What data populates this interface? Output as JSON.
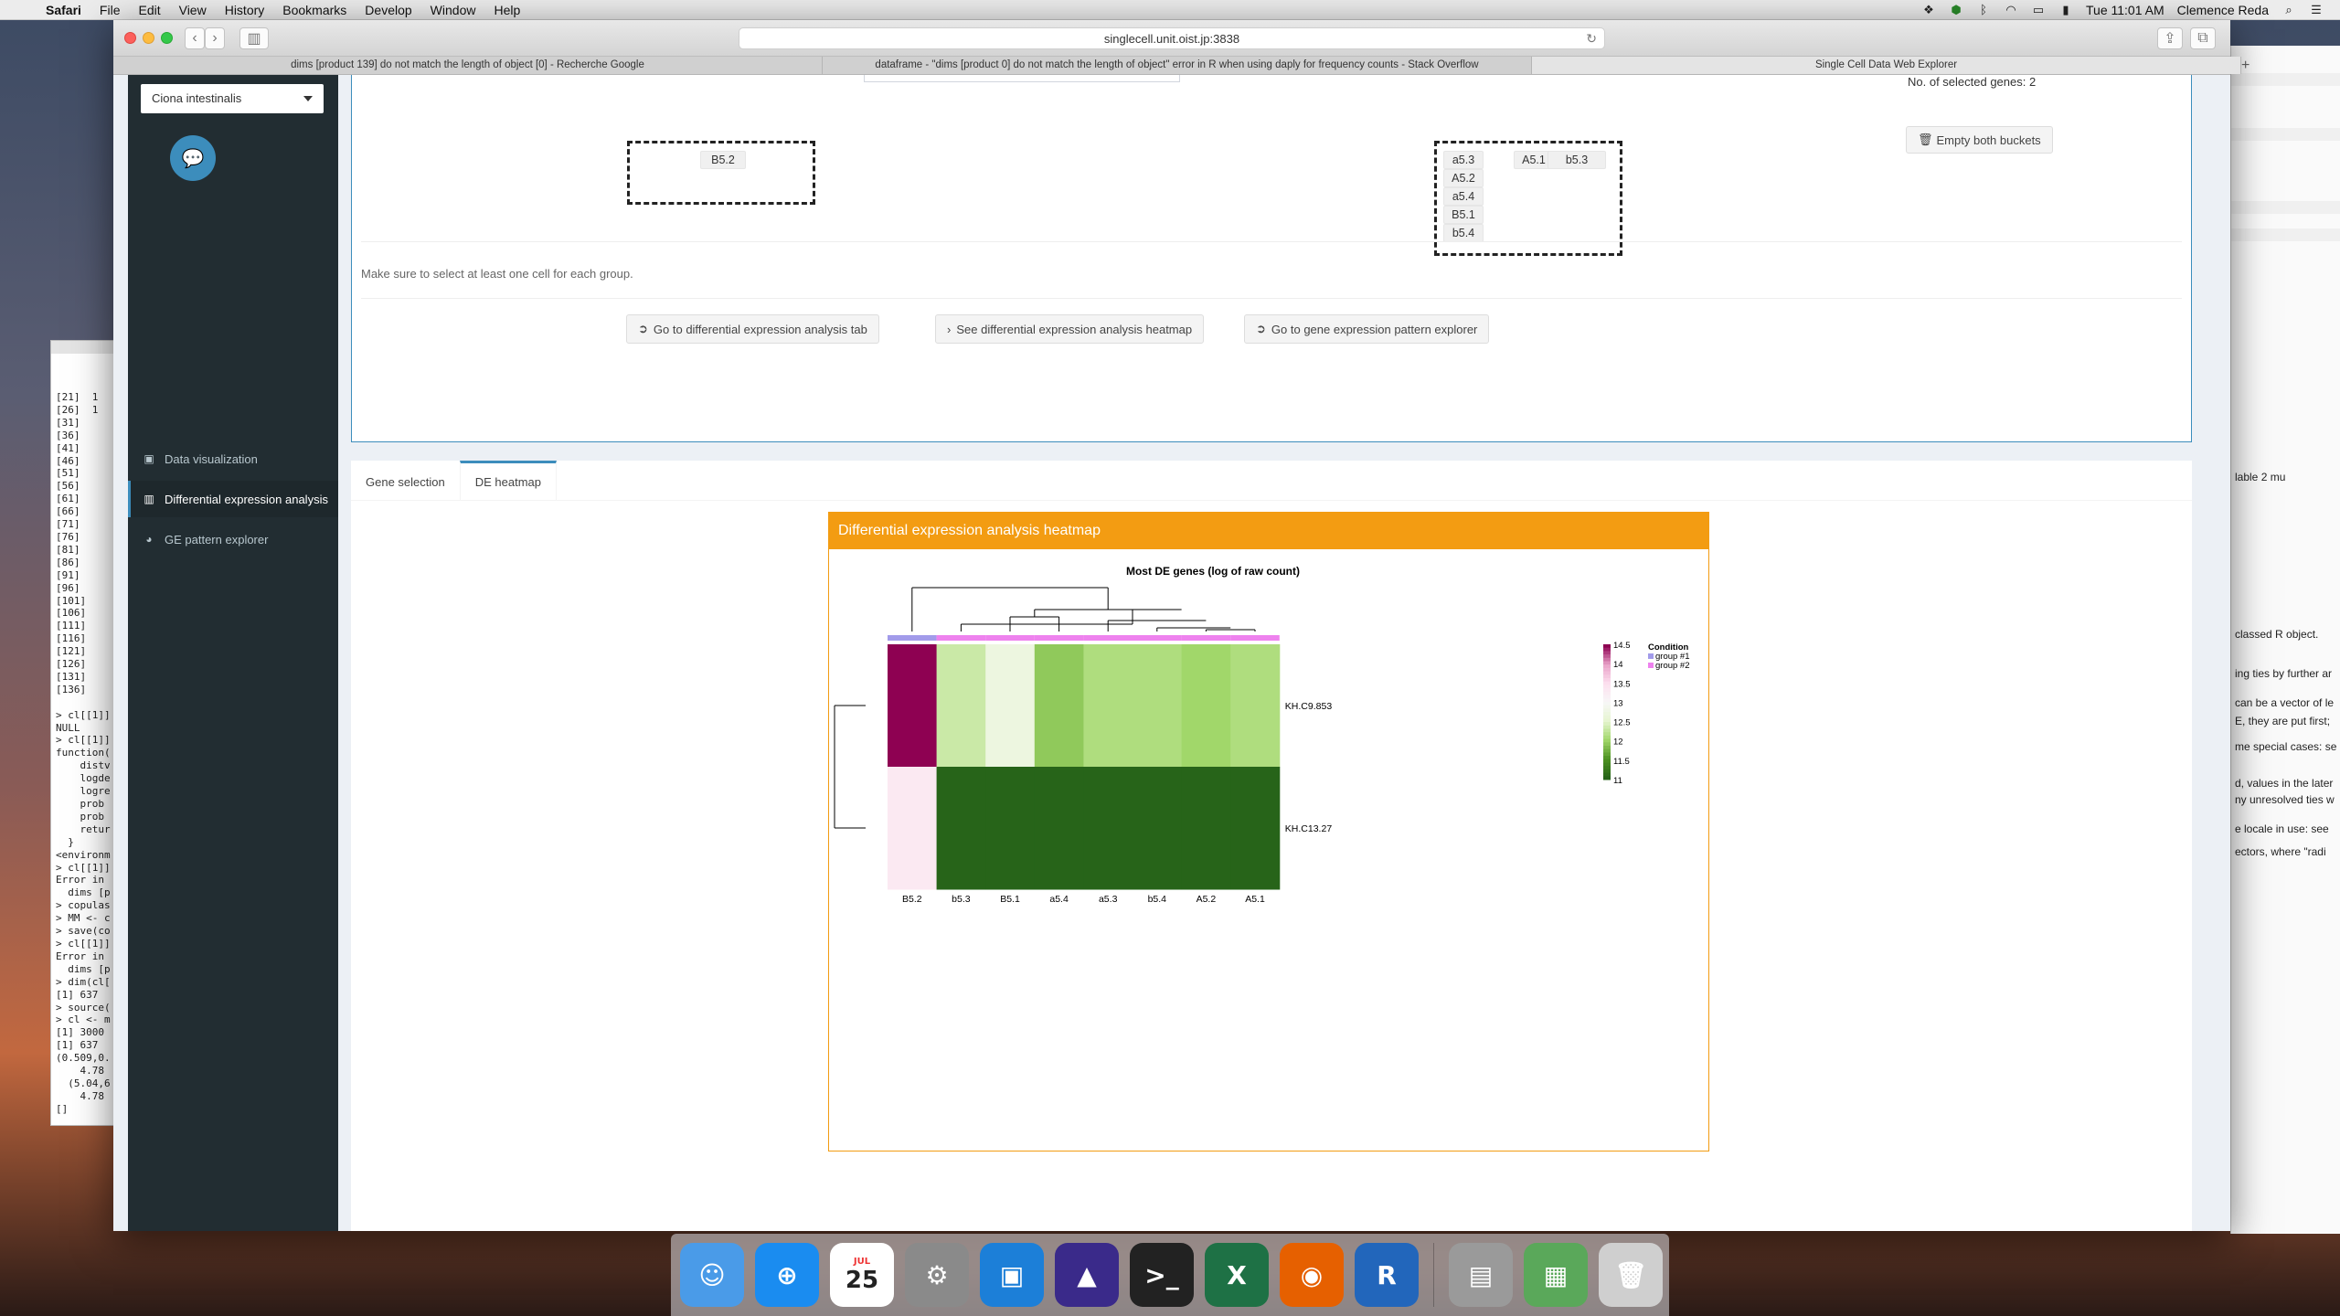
{
  "menubar": {
    "app": "Safari",
    "items": [
      "File",
      "Edit",
      "View",
      "History",
      "Bookmarks",
      "Develop",
      "Window",
      "Help"
    ],
    "clock": "Tue 11:01 AM",
    "user": "Clemence Reda"
  },
  "browser": {
    "url": "singlecell.unit.oist.jp:3838",
    "tabs": [
      "dims [product 139] do not match the length of object [0] - Recherche Google",
      "dataframe - \"dims [product 0] do not match the length of object\" error in R when using daply for frequency counts - Stack Overflow",
      "Single Cell Data Web Explorer"
    ],
    "new_tab": "+"
  },
  "sidebar": {
    "species": "Ciona intestinalis",
    "items": [
      {
        "label": "Data visualization",
        "icon": "image-icon",
        "glyph": "▣"
      },
      {
        "label": "Differential expression analysis",
        "icon": "bar-chart-icon",
        "glyph": "▥"
      },
      {
        "label": "GE pattern explorer",
        "icon": "pie-chart-icon",
        "glyph": "◕"
      }
    ]
  },
  "topbox": {
    "selected_genes": "No. of selected genes: 2",
    "bucket1": [
      "B5.2"
    ],
    "bucket2_col1": [
      "a5.3",
      "A5.2",
      "a5.4",
      "B5.1",
      "b5.4"
    ],
    "bucket2_col2": [
      "A5.1"
    ],
    "bucket2_col3": [
      "b5.3"
    ],
    "empty_buckets": "Empty both buckets",
    "note": "Make sure to select at least one cell for each group.",
    "buttons": {
      "go_de_tab": "Go to differential expression analysis tab",
      "see_heatmap": "See differential expression analysis heatmap",
      "go_ge_explorer": "Go to gene expression pattern explorer"
    }
  },
  "tabs": {
    "gene_selection": "Gene selection",
    "de_heatmap": "DE heatmap"
  },
  "heatmap": {
    "box_title": "Differential expression analysis heatmap",
    "plot_title": "Most DE genes (log of raw count)",
    "legend_title": "Condition",
    "legend_groups": [
      "group #1",
      "group #2"
    ],
    "group_colors": [
      "#a29bea",
      "#ee82ee"
    ]
  },
  "chart_data": {
    "type": "heatmap",
    "title": "Most DE genes (log of raw count)",
    "columns": [
      "B5.2",
      "b5.3",
      "B5.1",
      "a5.4",
      "a5.3",
      "b5.4",
      "A5.2",
      "A5.1"
    ],
    "column_group": [
      "group #1",
      "group #2",
      "group #2",
      "group #2",
      "group #2",
      "group #2",
      "group #2",
      "group #2"
    ],
    "rows": [
      "KH.C9.853",
      "KH.C13.27"
    ],
    "values": [
      [
        14.6,
        12.3,
        12.7,
        11.9,
        12.1,
        12.1,
        12.0,
        12.1
      ],
      [
        13.3,
        10.8,
        10.8,
        10.6,
        10.4,
        10.5,
        10.5,
        10.6
      ]
    ],
    "color_scale": {
      "min": 11,
      "max": 14.5,
      "ticks": [
        14.5,
        14,
        13.5,
        13,
        12.5,
        12,
        11.5,
        11
      ]
    }
  },
  "console": {
    "lines": [
      "[21]  1",
      "[26]  1",
      "[31]",
      "[36]",
      "[41]",
      "[46]",
      "[51]",
      "[56]",
      "[61]",
      "[66]",
      "[71]",
      "[76]",
      "[81]",
      "[86]",
      "[91]",
      "[96]",
      "[101]",
      "[106]",
      "[111]",
      "[116]",
      "[121]",
      "[126]",
      "[131]",
      "[136]",
      "",
      "> cl[[1]]",
      "NULL",
      "> cl[[1]]",
      "function(",
      "    distv",
      "    logde",
      "    logre",
      "    prob ",
      "    prob ",
      "    retur",
      "  }",
      "<environm",
      "> cl[[1]]",
      "Error in ",
      "  dims [p",
      "> copulas",
      "> MM <- c",
      "> save(co",
      "> cl[[1]]",
      "Error in ",
      "  dims [p",
      "> dim(cl[",
      "[1] 637",
      "> source(",
      "> cl <- m",
      "[1] 3000",
      "[1] 637",
      "(0.509,0.",
      "    4.78",
      "  (5.04,6",
      "    4.78",
      "[]"
    ]
  },
  "bgwindow": {
    "texts": [
      "ing ties by further ar",
      "classed R object.",
      "can be a vector of le",
      "E, they are put first;",
      "me special cases: se",
      "d, values in the later",
      "ny unresolved ties w",
      "e locale in use: see",
      "ectors, where \"radi",
      "   lable 2  mu"
    ]
  },
  "dock": {
    "apps": [
      {
        "name": "finder-icon",
        "glyph": "☺",
        "color": "#4a9be8"
      },
      {
        "name": "safari-icon",
        "glyph": "⊕",
        "color": "#1a8cf0"
      },
      {
        "name": "calendar-icon",
        "glyph": "25",
        "color": "#ffffff"
      },
      {
        "name": "system-preferences-icon",
        "glyph": "⚙",
        "color": "#8a8a8a"
      },
      {
        "name": "desktop-app-icon",
        "glyph": "▣",
        "color": "#1c7fd8"
      },
      {
        "name": "affinity-icon",
        "glyph": "▲",
        "color": "#3a2a8a"
      },
      {
        "name": "terminal-icon",
        "glyph": ">_",
        "color": "#222222"
      },
      {
        "name": "excel-icon",
        "glyph": "X",
        "color": "#1e7145"
      },
      {
        "name": "firefox-icon",
        "glyph": "◉",
        "color": "#e66000"
      },
      {
        "name": "r-icon",
        "glyph": "R",
        "color": "#2266bb"
      },
      {
        "name": "preview-icon",
        "glyph": "▤",
        "color": "#9a9a9a"
      },
      {
        "name": "spreadsheet-file-icon",
        "glyph": "▦",
        "color": "#5aa85a"
      },
      {
        "name": "trash-icon",
        "glyph": "🗑",
        "color": "#cfcfcf"
      }
    ],
    "calendar_month": "JUL"
  }
}
